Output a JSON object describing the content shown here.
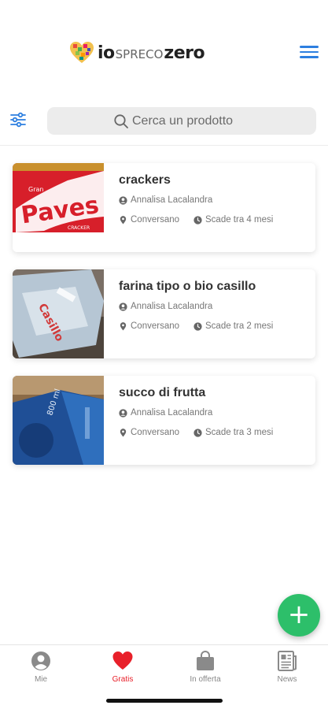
{
  "header": {
    "logo_prefix": "io",
    "logo_mid": "SPRECO",
    "logo_suffix": "zero"
  },
  "search": {
    "placeholder": "Cerca un prodotto"
  },
  "products": [
    {
      "name": "crackers",
      "user": "Annalisa Lacalandra",
      "location": "Conversano",
      "expiry": "Scade tra 4 mesi"
    },
    {
      "name": "farina tipo o bio casillo",
      "user": "Annalisa Lacalandra",
      "location": "Conversano",
      "expiry": "Scade tra 2 mesi"
    },
    {
      "name": "succo di frutta",
      "user": "Annalisa Lacalandra",
      "location": "Conversano",
      "expiry": "Scade tra 3 mesi"
    }
  ],
  "fab": {
    "icon": "plus-icon"
  },
  "tabs": [
    {
      "label": "Mie",
      "icon": "user-circle-icon",
      "active": false
    },
    {
      "label": "Gratis",
      "icon": "heart-icon",
      "active": true
    },
    {
      "label": "In offerta",
      "icon": "shopping-bag-icon",
      "active": false
    },
    {
      "label": "News",
      "icon": "newspaper-icon",
      "active": false
    }
  ],
  "colors": {
    "accent_blue": "#2d7fe0",
    "fab_green": "#2dbf6a",
    "active_red": "#e8202a",
    "inactive_gray": "#888888"
  }
}
